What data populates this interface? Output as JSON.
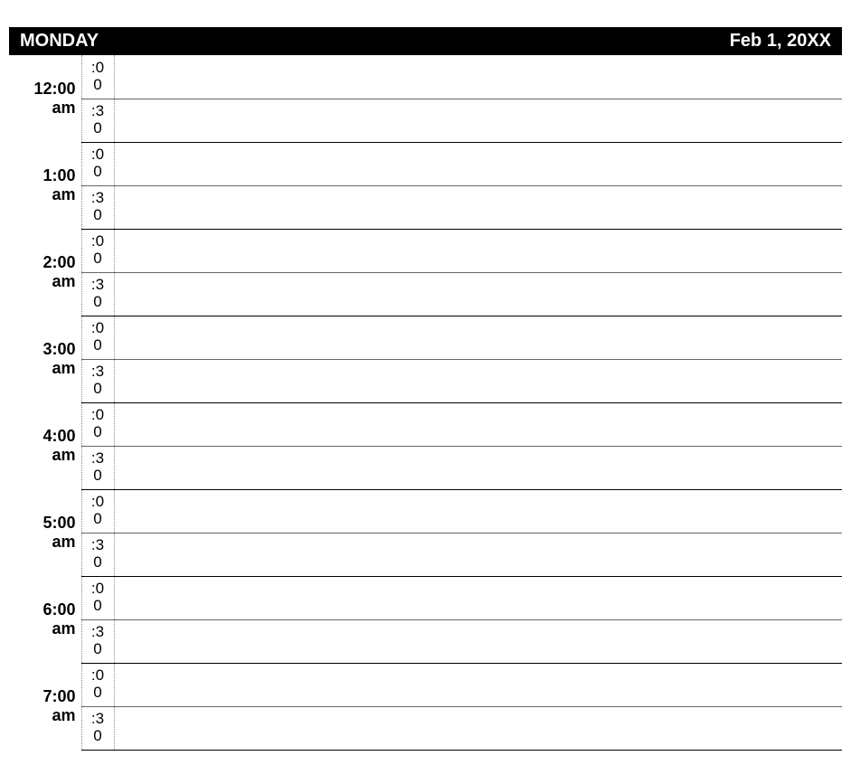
{
  "header": {
    "day": "MONDAY",
    "date": "Feb 1, 20XX"
  },
  "sublabels": {
    "top": ":00",
    "bottom": ":30"
  },
  "hours": [
    {
      "label": "12:00 am",
      "top_entry": "",
      "bottom_entry": ""
    },
    {
      "label": "1:00 am",
      "top_entry": "",
      "bottom_entry": ""
    },
    {
      "label": "2:00 am",
      "top_entry": "",
      "bottom_entry": ""
    },
    {
      "label": "3:00 am",
      "top_entry": "",
      "bottom_entry": ""
    },
    {
      "label": "4:00 am",
      "top_entry": "",
      "bottom_entry": ""
    },
    {
      "label": "5:00 am",
      "top_entry": "",
      "bottom_entry": ""
    },
    {
      "label": "6:00 am",
      "top_entry": "",
      "bottom_entry": ""
    },
    {
      "label": "7:00 am",
      "top_entry": "",
      "bottom_entry": ""
    }
  ]
}
